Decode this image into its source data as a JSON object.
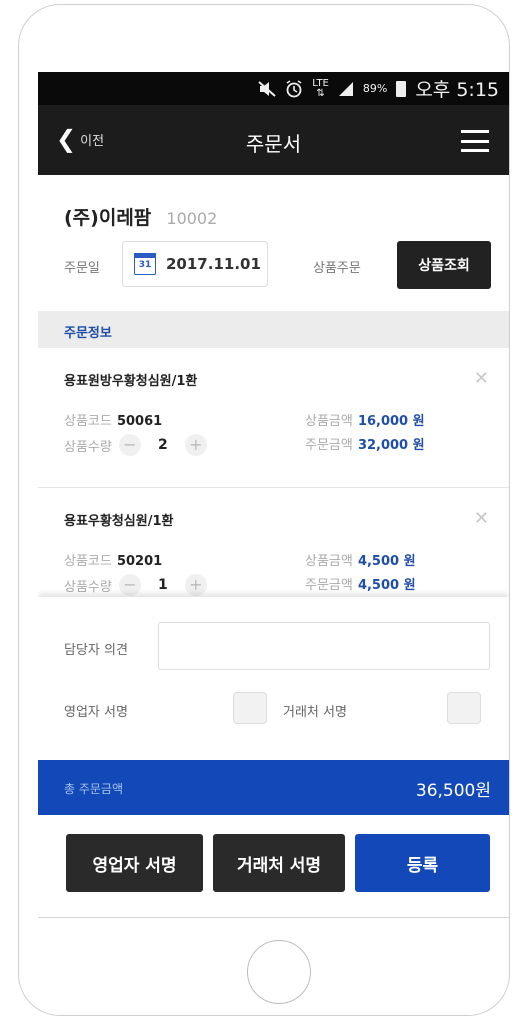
{
  "status_bar": {
    "mute_icon": "mute-icon",
    "alarm_icon": "alarm-icon",
    "network": "LTE",
    "battery_percent": "89%",
    "time": "오후 5:15"
  },
  "header": {
    "back_label": "이전",
    "title": "주문서"
  },
  "customer": {
    "name": "(주)이레팜",
    "code": "10002"
  },
  "order": {
    "date_label": "주문일",
    "date_value": "2017.11.01",
    "calendar_day": "31",
    "product_order_label": "상품주문",
    "search_button": "상품조회"
  },
  "section_title": "주문정보",
  "items": [
    {
      "name": "용표원방우황청심원/1환",
      "code_label": "상품코드",
      "code": "50061",
      "qty_label": "상품수량",
      "qty": "2",
      "price_label": "상품금액",
      "price": "16,000 원",
      "total_label": "주문금액",
      "total": "32,000 원"
    },
    {
      "name": "용표우황청심원/1환",
      "code_label": "상품코드",
      "code": "50201",
      "qty_label": "상품수량",
      "qty": "1",
      "price_label": "상품금액",
      "price": "4,500 원",
      "total_label": "주문금액",
      "total": "4,500 원"
    }
  ],
  "form": {
    "opinion_label": "담당자 의견",
    "opinion_value": "",
    "sales_sign_label": "영업자 서명",
    "client_sign_label": "거래처 서명"
  },
  "total": {
    "label": "총 주문금액",
    "value": "36,500원"
  },
  "actions": {
    "sales_sign_button": "영업자 서명",
    "client_sign_button": "거래처 서명",
    "register_button": "등록"
  },
  "colors": {
    "accent": "#1248b8",
    "header_bg": "#1c1c1c"
  }
}
